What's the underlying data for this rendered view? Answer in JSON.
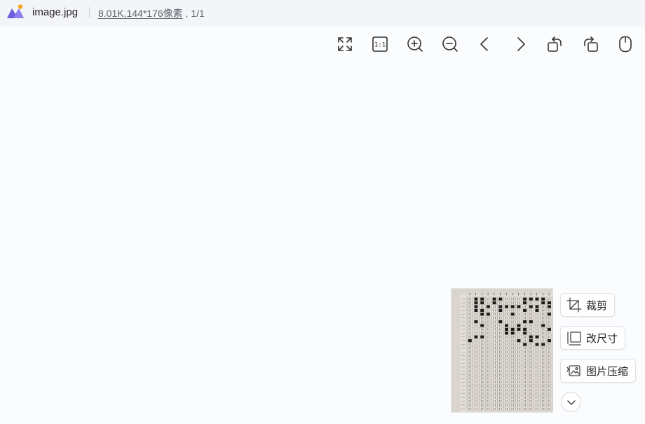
{
  "titlebar": {
    "filename": "image.jpg",
    "file_size": "8.01K",
    "dimensions": ",144*176像素",
    "page_counter": " , 1/1",
    "logo_icon": "app-logo-icon"
  },
  "toolbar": {
    "tools": [
      {
        "name": "fullscreen",
        "icon": "expand-arrows-icon"
      },
      {
        "name": "actual-size",
        "icon": "one-to-one-icon",
        "label": "1:1"
      },
      {
        "name": "zoom-in",
        "icon": "zoom-in-icon"
      },
      {
        "name": "zoom-out",
        "icon": "zoom-out-icon"
      },
      {
        "name": "previous",
        "icon": "chevron-left-icon"
      },
      {
        "name": "next",
        "icon": "chevron-right-icon"
      },
      {
        "name": "rotate-left",
        "icon": "rotate-left-icon"
      },
      {
        "name": "rotate-right",
        "icon": "rotate-right-icon"
      },
      {
        "name": "mouse-mode",
        "icon": "mouse-icon"
      }
    ]
  },
  "side_actions": {
    "crop_label": "裁剪",
    "resize_label": "改尺寸",
    "compress_label": "图片压缩",
    "expand_icon": "chevron-down-icon"
  },
  "colors": {
    "background": "#fbfcfe",
    "titlebar": "#f3f5f8",
    "logo_purple": "#6b5fe0",
    "logo_orange": "#f7a51c"
  }
}
